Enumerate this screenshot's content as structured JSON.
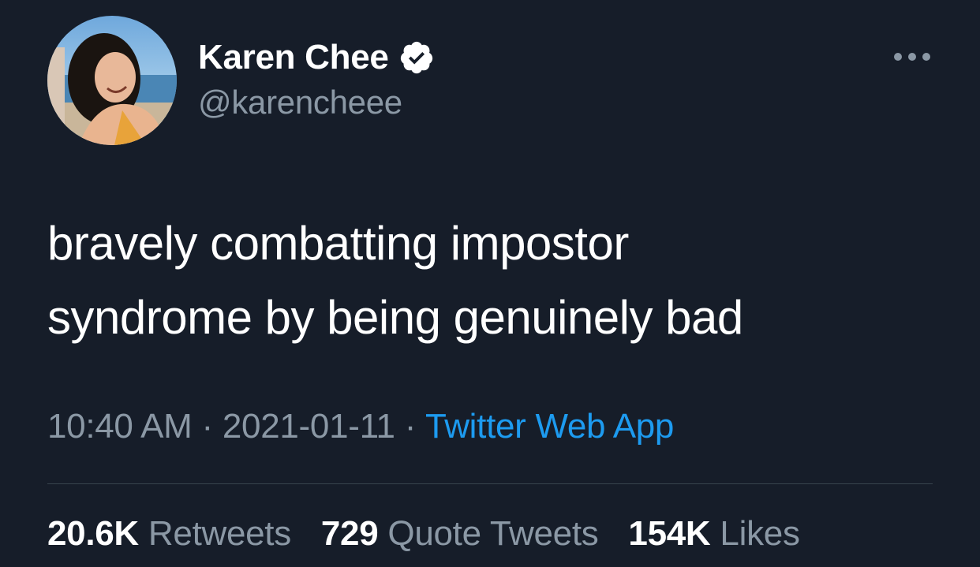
{
  "author": {
    "display_name": "Karen Chee",
    "handle": "@karencheee",
    "verified": true,
    "avatar_icon": "profile-photo"
  },
  "tweet": {
    "lines": [
      "bravely combatting impostor",
      "syndrome by being genuinely bad"
    ],
    "time": "10:40 AM",
    "separator": "·",
    "date": "2021-01-11",
    "source": "Twitter Web App"
  },
  "stats": {
    "retweets": {
      "count": "20.6K",
      "label": "Retweets"
    },
    "quotes": {
      "count": "729",
      "label": "Quote Tweets"
    },
    "likes": {
      "count": "154K",
      "label": "Likes"
    }
  },
  "icons": {
    "verified": "verified-badge-icon",
    "more": "more-horizontal-icon"
  },
  "colors": {
    "background": "#161d29",
    "text_primary": "#ffffff",
    "text_secondary": "#8b98a5",
    "link": "#1d9bf0",
    "divider": "#38444d"
  }
}
